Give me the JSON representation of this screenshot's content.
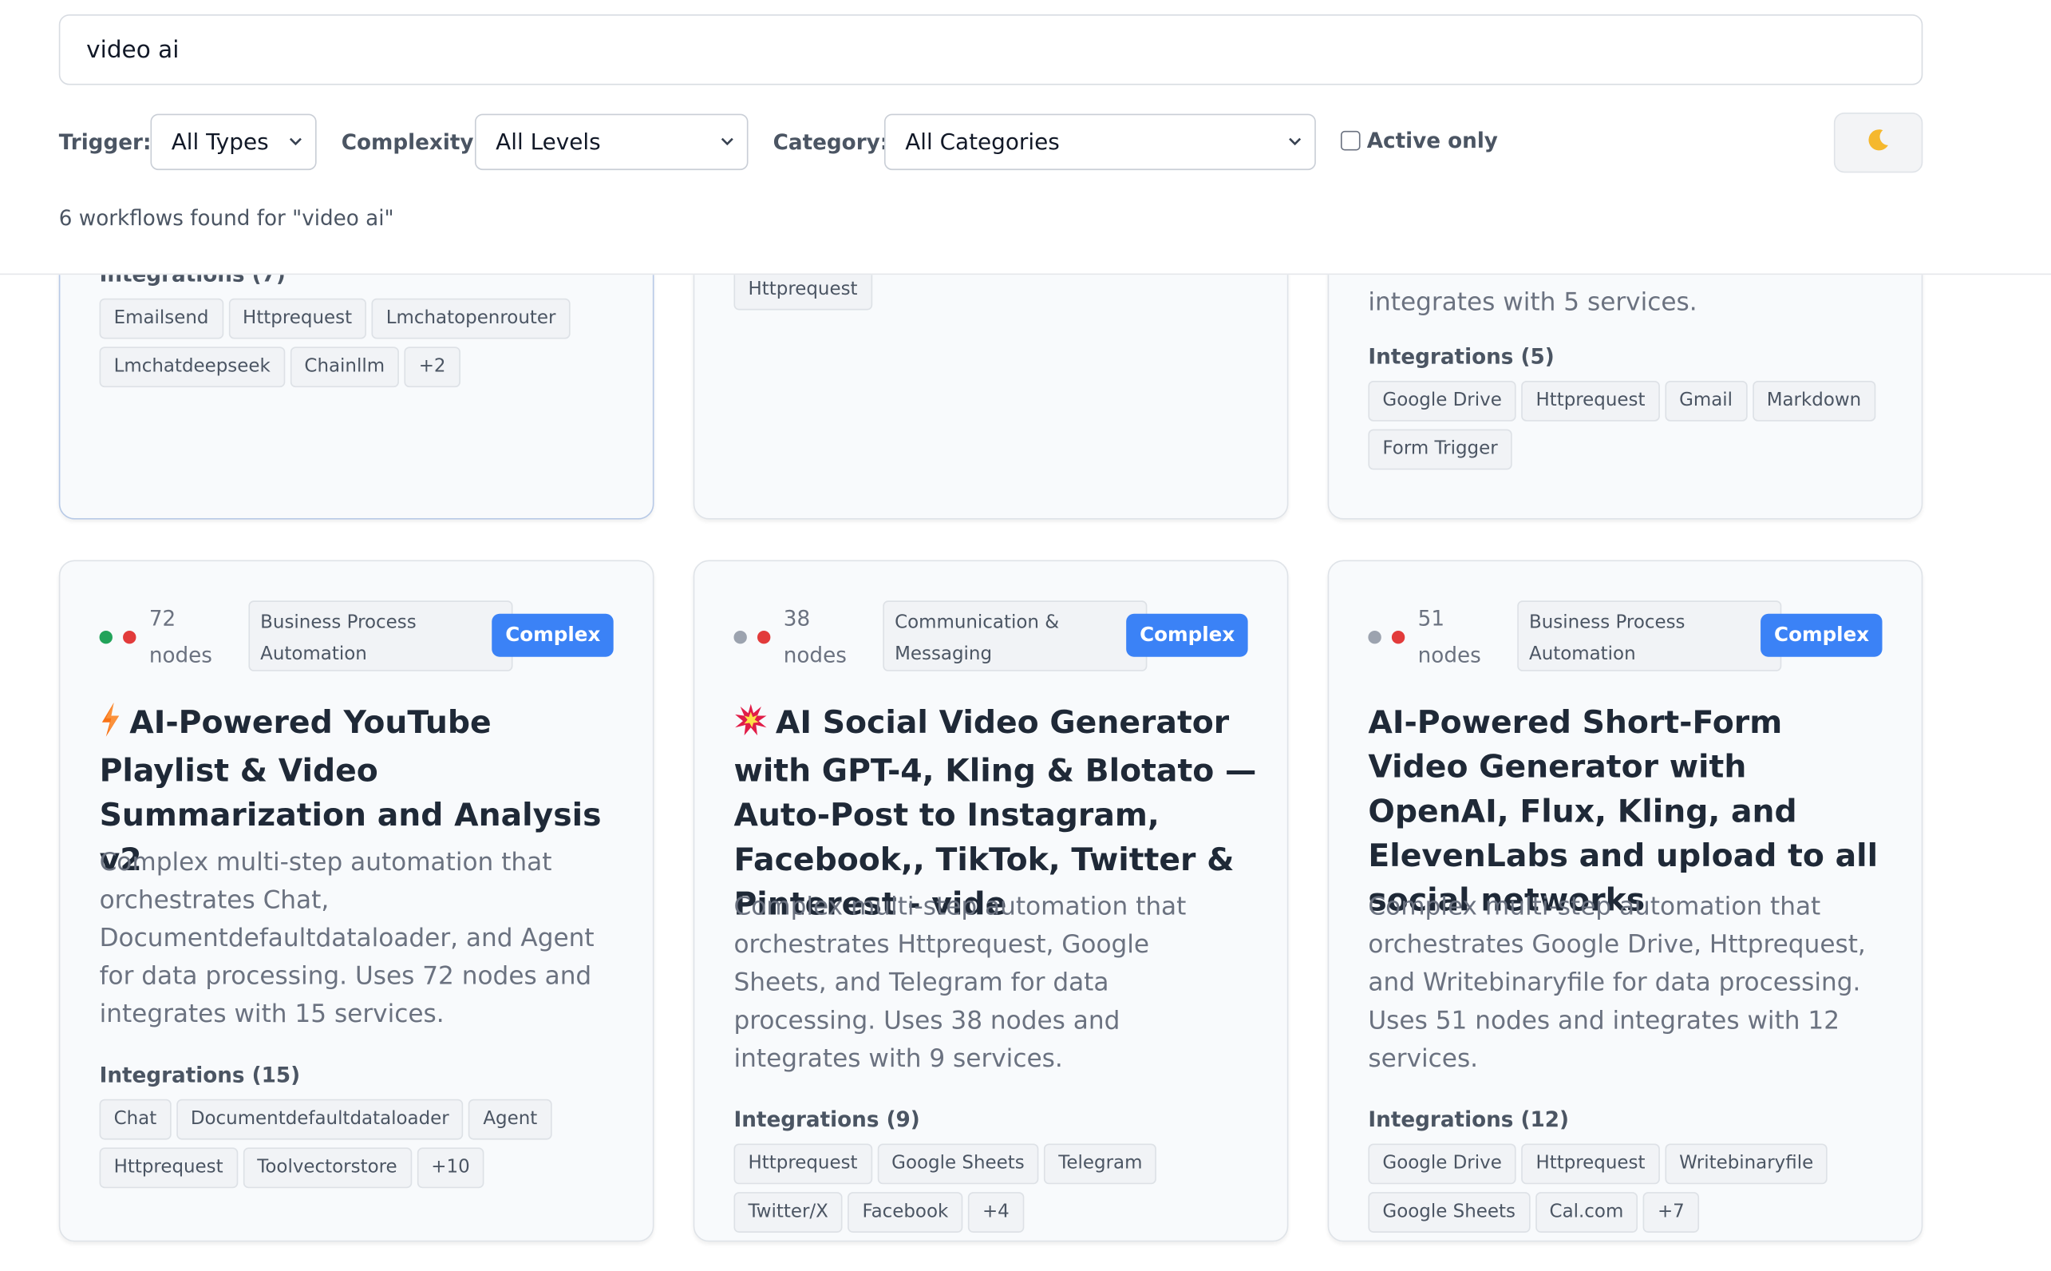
{
  "search": {
    "value": "video ai"
  },
  "filters": {
    "trigger_label": "Trigger:",
    "trigger_value": "All Types",
    "complexity_label": "Complexity:",
    "complexity_value": "All Levels",
    "category_label": "Category:",
    "category_value": "All Categories",
    "active_only_label": "Active only"
  },
  "theme_icon": "moon-icon",
  "results_text": "6 workflows found for \"video ai\"",
  "top_cards": [
    {
      "integrations_title": "Integrations (7)",
      "integrations": [
        "Emailsend",
        "Httprequest",
        "Lmchatopenrouter",
        "Lmchatdeepseek",
        "Chainllm",
        "+2"
      ]
    },
    {
      "integrations": [
        "Httprequest"
      ]
    },
    {
      "description_tail": "integrates with 5 services.",
      "integrations_title": "Integrations (5)",
      "integrations": [
        "Google Drive",
        "Httprequest",
        "Gmail",
        "Markdown",
        "Form Trigger"
      ]
    }
  ],
  "cards": [
    {
      "status_colors": [
        "#22a35a",
        "#e23b3b"
      ],
      "nodes": "72",
      "nodes_unit": "nodes",
      "category": "Business Process Automation",
      "complexity": "Complex",
      "icon": "lightning-icon",
      "title": "AI-Powered YouTube Playlist & Video Summarization and Analysis v2",
      "description": "Complex multi-step automation that orchestrates Chat, Documentdefaultdataloader, and Agent for data processing. Uses 72 nodes and integrates with 15 services.",
      "integrations_title": "Integrations (15)",
      "integrations": [
        "Chat",
        "Documentdefaultdataloader",
        "Agent",
        "Httprequest",
        "Toolvectorstore",
        "+10"
      ]
    },
    {
      "status_colors": [
        "#9ca3af",
        "#e23b3b"
      ],
      "nodes": "38",
      "nodes_unit": "nodes",
      "category": "Communication & Messaging",
      "complexity": "Complex",
      "icon": "explosion-icon",
      "title": "AI Social Video Generator with GPT-4, Kling & Blotato —Auto-Post to Instagram, Facebook,, TikTok, Twitter & Pinterest - vide",
      "description": "Complex multi-step automation that orchestrates Httprequest, Google Sheets, and Telegram for data processing. Uses 38 nodes and integrates with 9 services.",
      "integrations_title": "Integrations (9)",
      "integrations": [
        "Httprequest",
        "Google Sheets",
        "Telegram",
        "Twitter/X",
        "Facebook",
        "+4"
      ]
    },
    {
      "status_colors": [
        "#9ca3af",
        "#e23b3b"
      ],
      "nodes": "51",
      "nodes_unit": "nodes",
      "category": "Business Process Automation",
      "complexity": "Complex",
      "icon": "",
      "title": "AI-Powered Short-Form Video Generator with OpenAI, Flux, Kling, and ElevenLabs and upload to all social networks",
      "description": "Complex multi-step automation that orchestrates Google Drive, Httprequest, and Writebinaryfile for data processing. Uses 51 nodes and integrates with 12 services.",
      "integrations_title": "Integrations (12)",
      "integrations": [
        "Google Drive",
        "Httprequest",
        "Writebinaryfile",
        "Google Sheets",
        "Cal.com",
        "+7"
      ]
    }
  ]
}
